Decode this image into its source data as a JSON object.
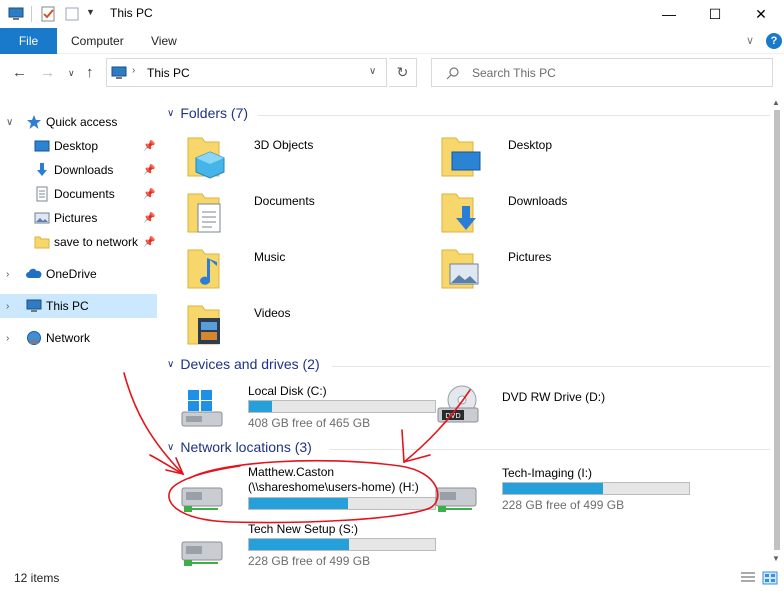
{
  "window": {
    "title": "This PC",
    "minimize_glyph": "—",
    "maximize_glyph": "☐",
    "close_glyph": "✕"
  },
  "ribbon": {
    "file_label": "File",
    "tabs": [
      "Computer",
      "View"
    ],
    "help_glyph": "?"
  },
  "nav": {
    "address_path": "This PC",
    "search_placeholder": "Search This PC"
  },
  "sidebar": {
    "quick_access": "Quick access",
    "items": [
      {
        "label": "Desktop",
        "icon": "desktop-icon",
        "pinned": true
      },
      {
        "label": "Downloads",
        "icon": "downloads-icon",
        "pinned": true
      },
      {
        "label": "Documents",
        "icon": "documents-icon",
        "pinned": true
      },
      {
        "label": "Pictures",
        "icon": "pictures-icon",
        "pinned": true
      },
      {
        "label": "save to network",
        "icon": "folder-icon",
        "pinned": true
      }
    ],
    "onedrive": "OneDrive",
    "this_pc": "This PC",
    "network": "Network"
  },
  "folders": {
    "heading": "Folders (7)",
    "items": [
      {
        "label": "3D Objects",
        "icon": "3d-objects-folder-icon"
      },
      {
        "label": "Desktop",
        "icon": "desktop-folder-icon"
      },
      {
        "label": "Documents",
        "icon": "documents-folder-icon"
      },
      {
        "label": "Downloads",
        "icon": "downloads-folder-icon"
      },
      {
        "label": "Music",
        "icon": "music-folder-icon"
      },
      {
        "label": "Pictures",
        "icon": "pictures-folder-icon"
      },
      {
        "label": "Videos",
        "icon": "videos-folder-icon"
      }
    ]
  },
  "devices": {
    "heading": "Devices and drives (2)",
    "items": [
      {
        "label": "Local Disk (C:)",
        "free": "408 GB free of 465 GB",
        "used_fraction": 0.123
      },
      {
        "label": "DVD RW Drive (D:)",
        "badge": "DVD"
      }
    ]
  },
  "network_locations": {
    "heading": "Network locations (3)",
    "items": [
      {
        "label_line1": "Matthew.Caston",
        "label_line2": "(\\\\shareshome\\users-home) (H:)",
        "used_fraction": 0.53
      },
      {
        "label": "Tech-Imaging (I:)",
        "free": "228 GB free of 499 GB",
        "used_fraction": 0.54
      },
      {
        "label": "Tech New Setup (S:)",
        "free": "228 GB free of 499 GB",
        "used_fraction": 0.54
      }
    ]
  },
  "status": {
    "items_count": "12 items"
  },
  "colors": {
    "accent": "#1979ca",
    "selection": "#cce8ff",
    "drive_fill": "#26a0da",
    "group_heading": "#1e3287",
    "annotation": "#e2141c"
  }
}
